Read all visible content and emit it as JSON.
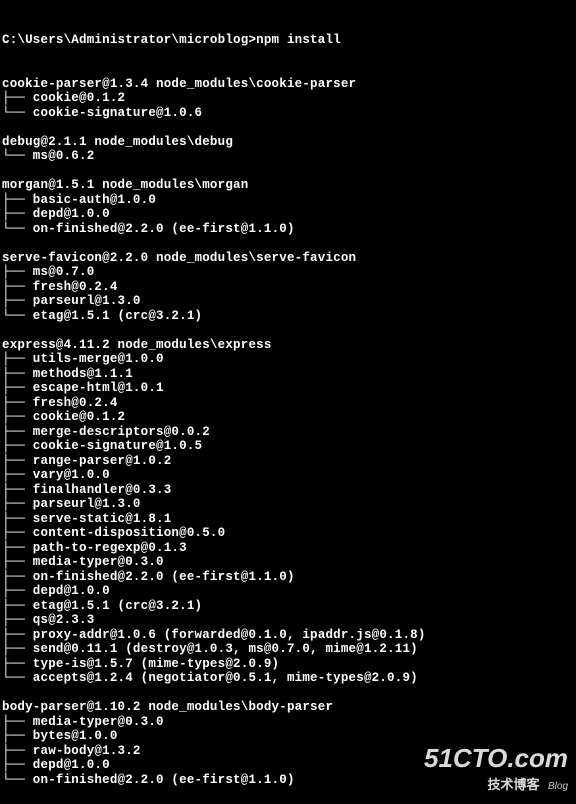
{
  "prompt": "C:\\Users\\Administrator\\microblog>npm install",
  "blocks": [
    {
      "header": "cookie-parser@1.3.4 node_modules\\cookie-parser",
      "deps": [
        "cookie@0.1.2",
        "cookie-signature@1.0.6"
      ]
    },
    {
      "header": "debug@2.1.1 node_modules\\debug",
      "deps": [
        "ms@0.6.2"
      ]
    },
    {
      "header": "morgan@1.5.1 node_modules\\morgan",
      "deps": [
        "basic-auth@1.0.0",
        "depd@1.0.0",
        "on-finished@2.2.0 (ee-first@1.1.0)"
      ]
    },
    {
      "header": "serve-favicon@2.2.0 node_modules\\serve-favicon",
      "deps": [
        "ms@0.7.0",
        "fresh@0.2.4",
        "parseurl@1.3.0",
        "etag@1.5.1 (crc@3.2.1)"
      ]
    },
    {
      "header": "express@4.11.2 node_modules\\express",
      "deps": [
        "utils-merge@1.0.0",
        "methods@1.1.1",
        "escape-html@1.0.1",
        "fresh@0.2.4",
        "cookie@0.1.2",
        "merge-descriptors@0.0.2",
        "cookie-signature@1.0.5",
        "range-parser@1.0.2",
        "vary@1.0.0",
        "finalhandler@0.3.3",
        "parseurl@1.3.0",
        "serve-static@1.8.1",
        "content-disposition@0.5.0",
        "path-to-regexp@0.1.3",
        "media-typer@0.3.0",
        "on-finished@2.2.0 (ee-first@1.1.0)",
        "depd@1.0.0",
        "etag@1.5.1 (crc@3.2.1)",
        "qs@2.3.3",
        "proxy-addr@1.0.6 (forwarded@0.1.0, ipaddr.js@0.1.8)",
        "send@0.11.1 (destroy@1.0.3, ms@0.7.0, mime@1.2.11)",
        "type-is@1.5.7 (mime-types@2.0.9)",
        "accepts@1.2.4 (negotiator@0.5.1, mime-types@2.0.9)"
      ]
    },
    {
      "header": "body-parser@1.10.2 node_modules\\body-parser",
      "deps": [
        "media-typer@0.3.0",
        "bytes@1.0.0",
        "raw-body@1.3.2",
        "depd@1.0.0",
        "on-finished@2.2.0 (ee-first@1.1.0)"
      ],
      "noTrailingBlank": true
    }
  ],
  "tree": {
    "branch": "├── ",
    "last": "└── "
  },
  "watermark": {
    "site": "51CTO.com",
    "sub": "技术博客",
    "blog": "Blog"
  }
}
